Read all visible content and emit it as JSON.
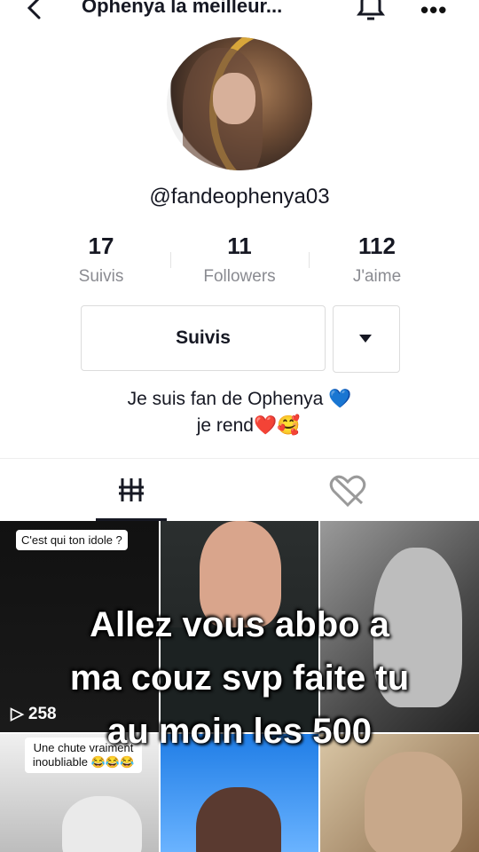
{
  "header": {
    "title": "Ophenya la meilleur...",
    "icons": [
      "back-icon",
      "bell-icon",
      "more-icon"
    ]
  },
  "profile": {
    "username": "@fandeophenya03",
    "stats": [
      {
        "value": "17",
        "label": "Suivis"
      },
      {
        "value": "11",
        "label": "Followers"
      },
      {
        "value": "112",
        "label": "J'aime"
      }
    ],
    "follow_button": "Suivis",
    "bio_line1": "Je suis fan de Ophenya 💙",
    "bio_line2": "je rend❤️🥰"
  },
  "tabs": {
    "items": [
      "grid-icon",
      "liked-heart-icon"
    ],
    "active": 0
  },
  "videos": [
    {
      "caption": "C'est qui ton idole ?",
      "views": "258"
    },
    {
      "caption": "",
      "views": ""
    },
    {
      "caption": "",
      "views": ""
    },
    {
      "caption": "Une chute vraiment inoubliable 😂😂😂",
      "views": ""
    },
    {
      "caption": "",
      "views": ""
    },
    {
      "caption": "",
      "views": ""
    }
  ],
  "overlay_text": {
    "line1": "Allez vous abbo a",
    "line2": "ma couz svp faite tu",
    "line3": "au moin les 500"
  },
  "colors": {
    "text": "#161823",
    "muted": "#8a8b91",
    "border": "#dcdcdc"
  }
}
